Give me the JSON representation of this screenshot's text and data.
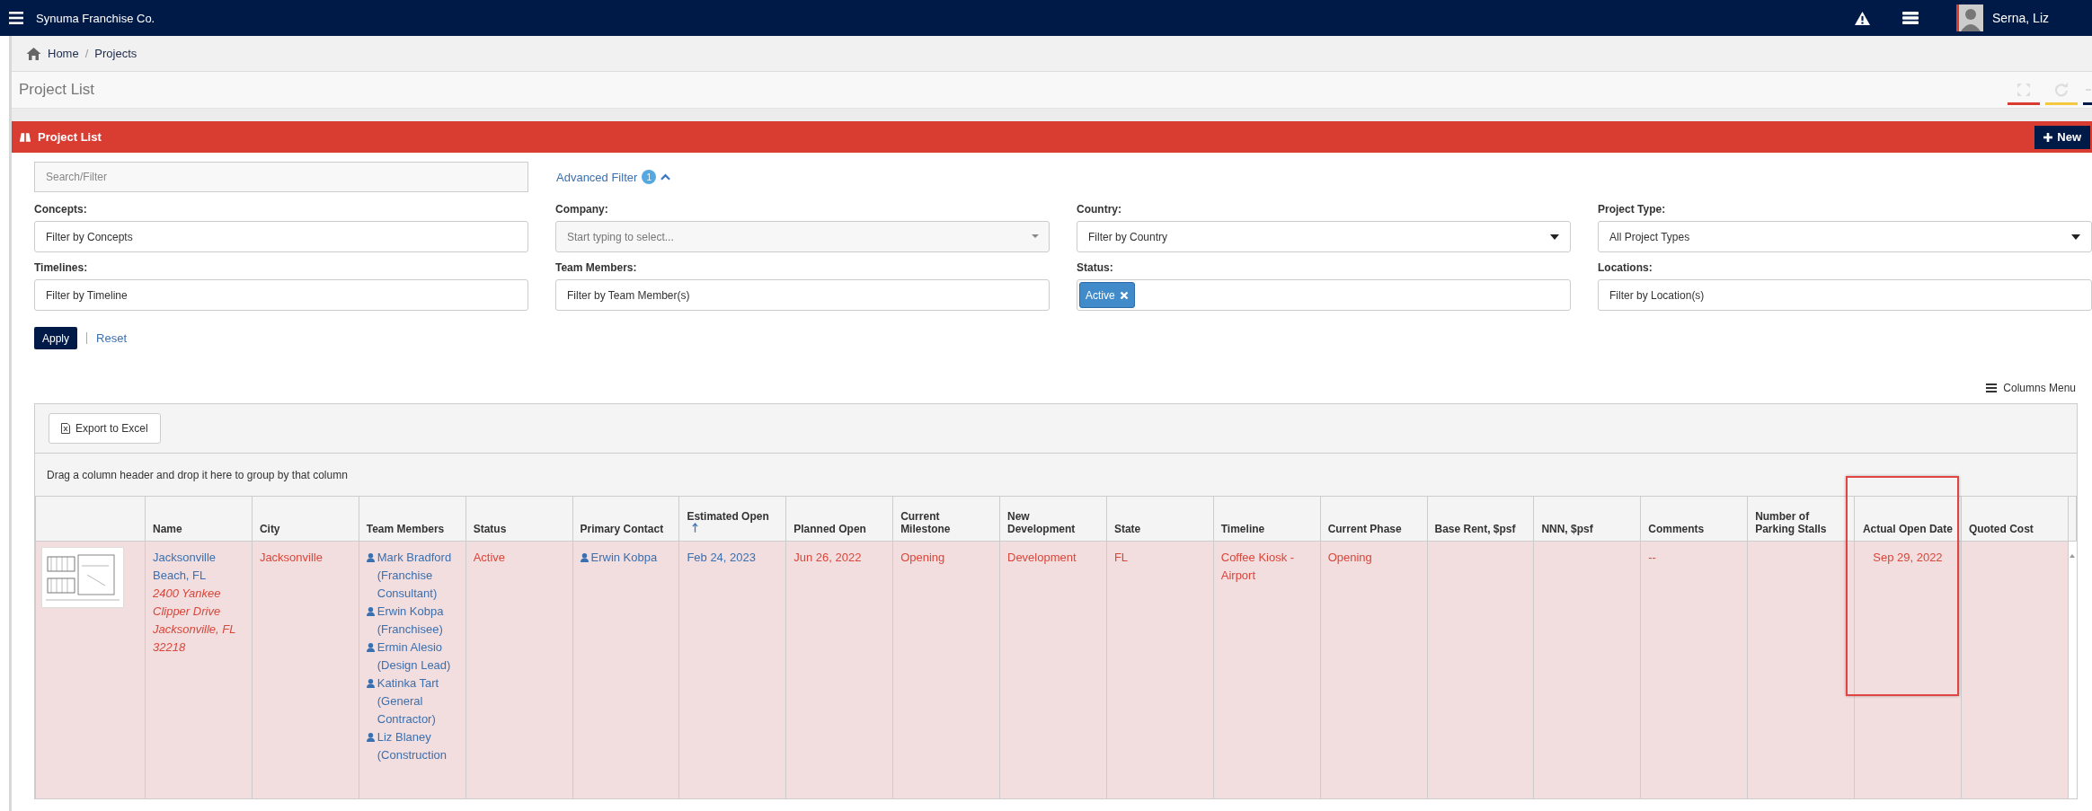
{
  "app": {
    "title": "Synuma Franchise Co.",
    "user": "Serna, Liz"
  },
  "breadcrumb": {
    "separator": "/",
    "items": [
      {
        "label": "Home"
      },
      {
        "label": "Projects"
      }
    ]
  },
  "page_title": "Project List",
  "panel": {
    "title": "Project List",
    "new_button": "New"
  },
  "search": {
    "placeholder": "Search/Filter"
  },
  "advanced_filter": {
    "label": "Advanced Filter",
    "count": "1",
    "expanded": true
  },
  "filters": [
    {
      "label": "Concepts:",
      "kind": "text",
      "placeholder": "Filter by Concepts"
    },
    {
      "label": "Company:",
      "kind": "combo",
      "placeholder": "Start typing to select..."
    },
    {
      "label": "Country:",
      "kind": "select",
      "value": "Filter by Country"
    },
    {
      "label": "Project Type:",
      "kind": "select",
      "value": "All Project Types"
    },
    {
      "label": "Timelines:",
      "kind": "text",
      "placeholder": "Filter by Timeline"
    },
    {
      "label": "Team Members:",
      "kind": "text",
      "placeholder": "Filter by Team Member(s)"
    },
    {
      "label": "Status:",
      "kind": "tags",
      "tags": [
        "Active"
      ]
    },
    {
      "label": "Locations:",
      "kind": "text",
      "placeholder": "Filter by Location(s)"
    }
  ],
  "actions": {
    "apply": "Apply",
    "reset": "Reset"
  },
  "columns_menu": "Columns Menu",
  "grid": {
    "export": "Export to Excel",
    "group_hint": "Drag a column header and drop it here to group by that column",
    "columns": [
      {
        "label": "Name",
        "sorted": false,
        "highlighted": false
      },
      {
        "label": "City",
        "sorted": false,
        "highlighted": false
      },
      {
        "label": "Team Members",
        "sorted": false,
        "highlighted": false
      },
      {
        "label": "Status",
        "sorted": false,
        "highlighted": false
      },
      {
        "label": "Primary Contact",
        "sorted": false,
        "highlighted": false
      },
      {
        "label": "Estimated Open",
        "sorted": true,
        "highlighted": false
      },
      {
        "label": "Planned Open",
        "sorted": false,
        "highlighted": false
      },
      {
        "label": "Current Milestone",
        "sorted": false,
        "highlighted": false
      },
      {
        "label": "New Development",
        "sorted": false,
        "highlighted": false
      },
      {
        "label": "State",
        "sorted": false,
        "highlighted": false
      },
      {
        "label": "Timeline",
        "sorted": false,
        "highlighted": false
      },
      {
        "label": "Current Phase",
        "sorted": false,
        "highlighted": false
      },
      {
        "label": "Base Rent, $psf",
        "sorted": false,
        "highlighted": false
      },
      {
        "label": "NNN, $psf",
        "sorted": false,
        "highlighted": false
      },
      {
        "label": "Comments",
        "sorted": false,
        "highlighted": false
      },
      {
        "label": "Number of Parking Stalls",
        "sorted": false,
        "highlighted": false
      },
      {
        "label": "Actual Open Date",
        "sorted": false,
        "highlighted": true
      },
      {
        "label": "Quoted Cost",
        "sorted": false,
        "highlighted": false
      }
    ],
    "rows": [
      {
        "cells": [
          {
            "kind": "location",
            "text": "Jacksonville Beach, FL",
            "address": "2400 Yankee Clipper Drive Jacksonville, FL 32218"
          },
          {
            "kind": "text",
            "text": "Jacksonville"
          },
          {
            "kind": "people",
            "people": [
              {
                "name": "Mark Bradford",
                "role": "(Franchise Consultant)"
              },
              {
                "name": "Erwin Kobpa",
                "role": "(Franchisee)"
              },
              {
                "name": "Ermin Alesio",
                "role": "(Design Lead)"
              },
              {
                "name": "Katinka Tart",
                "role": "(General Contractor)"
              },
              {
                "name": "Liz Blaney",
                "role": "(Construction"
              }
            ]
          },
          {
            "kind": "text",
            "text": "Active"
          },
          {
            "kind": "people",
            "people": [
              {
                "name": "Erwin Kobpa"
              }
            ]
          },
          {
            "kind": "link",
            "text": "Feb 24, 2023"
          },
          {
            "kind": "text",
            "text": "Jun 26, 2022"
          },
          {
            "kind": "text",
            "text": "Opening"
          },
          {
            "kind": "text",
            "text": "Development"
          },
          {
            "kind": "text",
            "text": "FL"
          },
          {
            "kind": "text",
            "text": "Coffee Kiosk - Airport"
          },
          {
            "kind": "text",
            "text": "Opening"
          },
          {
            "kind": "empty"
          },
          {
            "kind": "empty"
          },
          {
            "kind": "text",
            "text": "--"
          },
          {
            "kind": "empty"
          },
          {
            "kind": "date",
            "text": "Sep 29, 2022"
          },
          {
            "kind": "empty"
          }
        ]
      }
    ]
  }
}
